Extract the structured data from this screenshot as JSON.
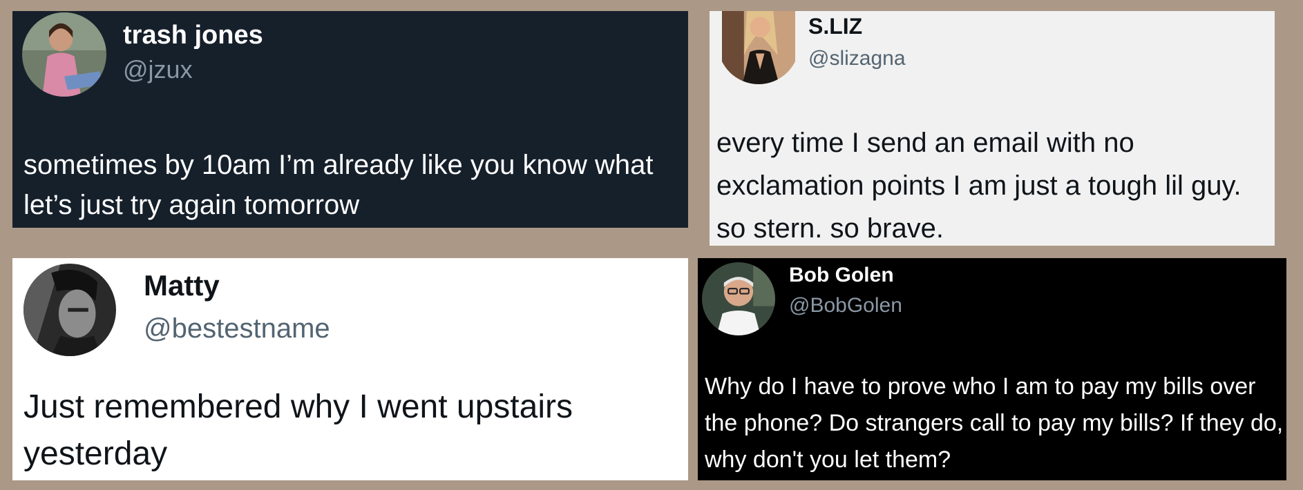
{
  "tweets": [
    {
      "display_name": "trash jones",
      "handle": "@jzux",
      "text": "sometimes by 10am I’m already like you know what let’s just try again tomorrow",
      "theme": "dim",
      "colors": {
        "background": "#16202b",
        "text": "#ffffff",
        "handle": "#8b98a5"
      }
    },
    {
      "display_name": "S.LIZ",
      "handle": "@slizagna",
      "text": "every time I send an email with no exclamation points I am just a tough lil guy. so stern. so brave.",
      "theme": "light",
      "colors": {
        "background": "#f1f1f1",
        "text": "#0f1419",
        "handle": "#536471"
      }
    },
    {
      "display_name": "Matty",
      "handle": "@bestestname",
      "text": "Just remembered why I went upstairs yesterday",
      "theme": "light",
      "colors": {
        "background": "#ffffff",
        "text": "#0f1419",
        "handle": "#536471"
      }
    },
    {
      "display_name": "Bob Golen",
      "handle": "@BobGolen",
      "text": "Why do I have to prove who I am to pay my bills over the phone?  Do strangers call to pay my bills?  If they do, why don't you let them?",
      "theme": "dark",
      "colors": {
        "background": "#000000",
        "text": "#ffffff",
        "handle": "#8b98a5"
      }
    }
  ],
  "page": {
    "background": "#ab9887"
  }
}
